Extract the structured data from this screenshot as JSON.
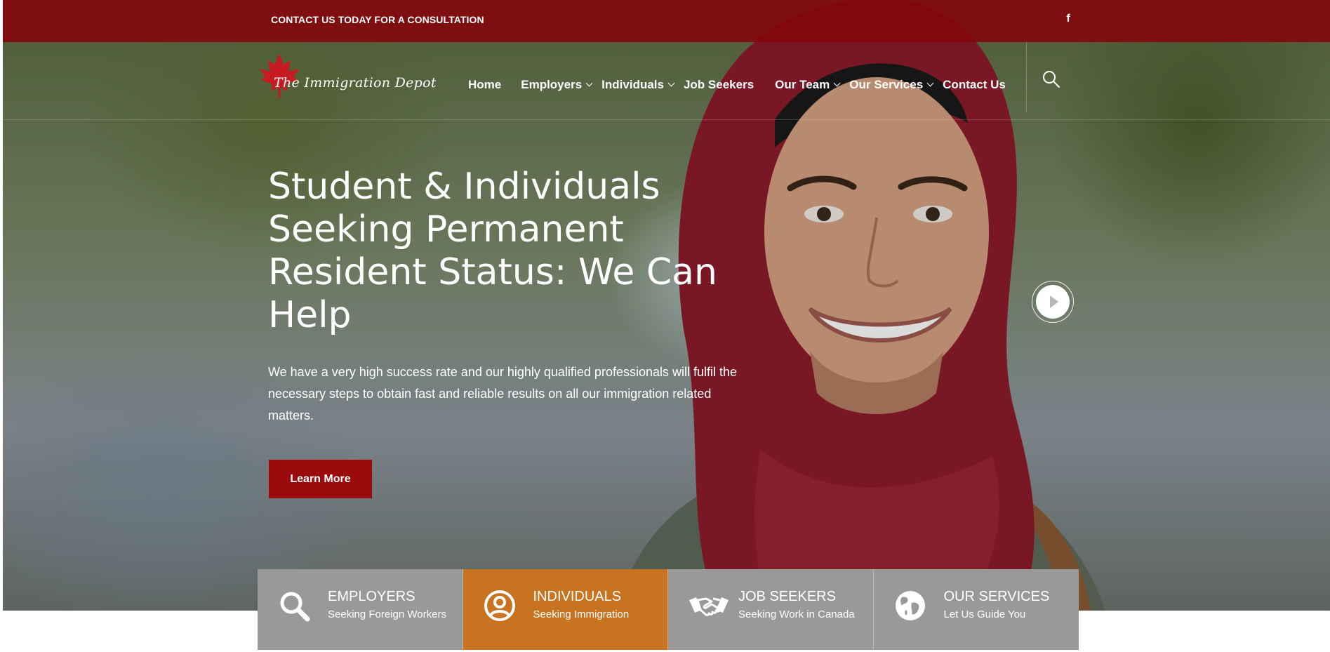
{
  "topbar": {
    "cta_text": "CONTACT US TODAY FOR A CONSULTATION",
    "social_icon": "f"
  },
  "brand": {
    "logo_text": "The Immigration Depot",
    "accent_color": "#9b0a0d"
  },
  "nav": {
    "items": [
      {
        "label": "Home",
        "has_dropdown": false
      },
      {
        "label": "Employers",
        "has_dropdown": true
      },
      {
        "label": "Individuals",
        "has_dropdown": true
      },
      {
        "label": "Job Seekers",
        "has_dropdown": false
      },
      {
        "label": "Our Team",
        "has_dropdown": true
      },
      {
        "label": "Our Services",
        "has_dropdown": true
      },
      {
        "label": "Contact Us",
        "has_dropdown": false
      }
    ],
    "search_icon": "search-icon"
  },
  "hero": {
    "headline": "Student & Individuals Seeking Permanent Resident Status: We Can Help",
    "lead": "We have a very high success rate and our highly qualified professionals will fulfil the necessary steps to obtain fast and reliable results on all our immigration related matters.",
    "button_label": "Learn More",
    "next_icon": "play-arrow-icon"
  },
  "features": [
    {
      "title": "EMPLOYERS",
      "subtitle": "Seeking Foreign Workers",
      "icon": "search-icon",
      "color": "#999999"
    },
    {
      "title": "INDIVIDUALS",
      "subtitle": "Seeking Immigration",
      "icon": "user-circle-icon",
      "color": "#c87320"
    },
    {
      "title": "JOB SEEKERS",
      "subtitle": "Seeking Work in Canada",
      "icon": "handshake-icon",
      "color": "#999999"
    },
    {
      "title": "OUR SERVICES",
      "subtitle": "Let Us Guide You",
      "icon": "globe-icon",
      "color": "#999999"
    }
  ]
}
